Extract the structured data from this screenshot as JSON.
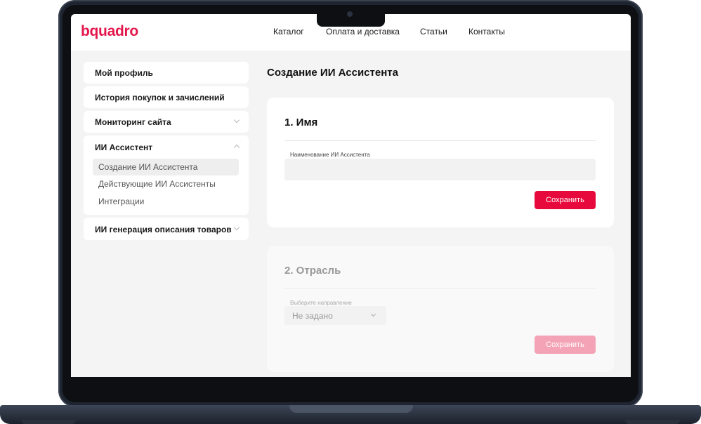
{
  "brand": {
    "logo": "bquadro",
    "accent": "#e8093c"
  },
  "nav": {
    "items": [
      "Каталог",
      "Оплата и доставка",
      "Статьи",
      "Контакты"
    ]
  },
  "sidebar": {
    "profile": "Мой профиль",
    "history": "История покупок и зачислений",
    "monitoring": "Мониторинг сайта",
    "assistant": {
      "title": "ИИ Ассистент",
      "items": [
        "Создание ИИ Ассистента",
        "Действующие ИИ Ассистенты",
        "Интеграции"
      ]
    },
    "generation": "ИИ генерация описания товаров"
  },
  "main": {
    "title": "Создание ИИ Ассистента",
    "step1": {
      "heading": "1. Имя",
      "field_label": "Наименование ИИ Ассистента",
      "field_value": "",
      "button": "Сохранить"
    },
    "step2": {
      "heading": "2. Отрасль",
      "field_label": "Выберите направление",
      "select_value": "Не задано",
      "button": "Сохранить"
    }
  }
}
